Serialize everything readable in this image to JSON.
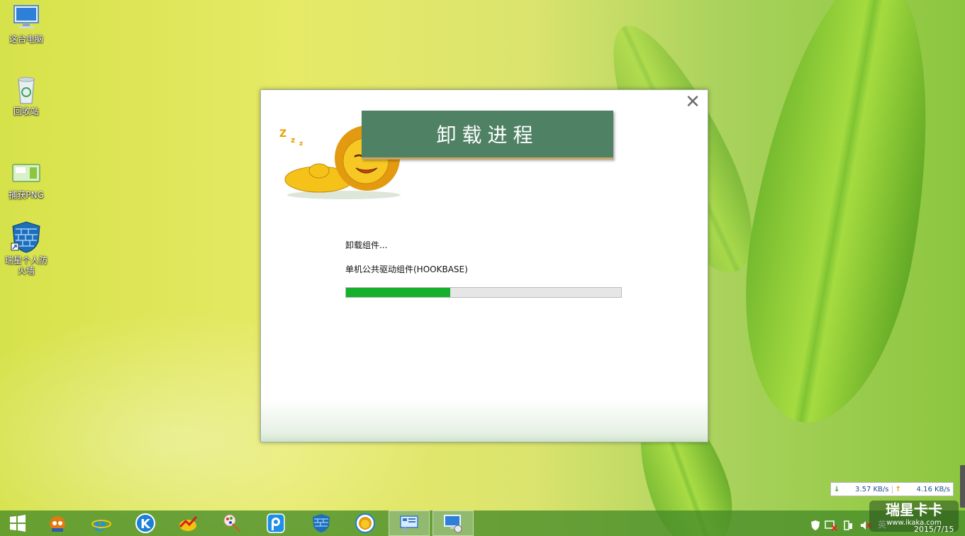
{
  "desktop": {
    "icons": [
      {
        "label": "这台电脑",
        "icon": "computer-icon"
      },
      {
        "label": "回收站",
        "icon": "recycle-bin-icon"
      },
      {
        "label": "捕获PNG",
        "icon": "image-file-icon"
      },
      {
        "label": "瑞星个人防\n火墙",
        "icon": "firewall-icon"
      }
    ]
  },
  "dialog": {
    "title": "卸载进程",
    "status": "卸载组件...",
    "component": "单机公共驱动组件(HOOKBASE)",
    "progress": 0.38,
    "close_icon": "close-icon",
    "mascot": "sleeping-lion-icon"
  },
  "netmon": {
    "download": "3.57 KB/s",
    "upload": "4.16 KB/s"
  },
  "taskbar": {
    "apps": [
      "windows-start-icon",
      "rising-fox-icon",
      "internet-explorer-icon",
      "kugou-icon",
      "stock-chart-icon",
      "paint-tools-icon",
      "pptv-icon",
      "firewall-icon",
      "lion-app-icon",
      "control-panel-icon",
      "display-settings-icon"
    ]
  },
  "tray": {
    "language": "英",
    "date": "2015/7/15"
  },
  "watermark": {
    "brand": "瑞星卡卡",
    "url": "www.ikaka.com"
  },
  "colors": {
    "banner": "#4f8165",
    "progress": "#15b12c",
    "taskbar": "#468c28"
  }
}
